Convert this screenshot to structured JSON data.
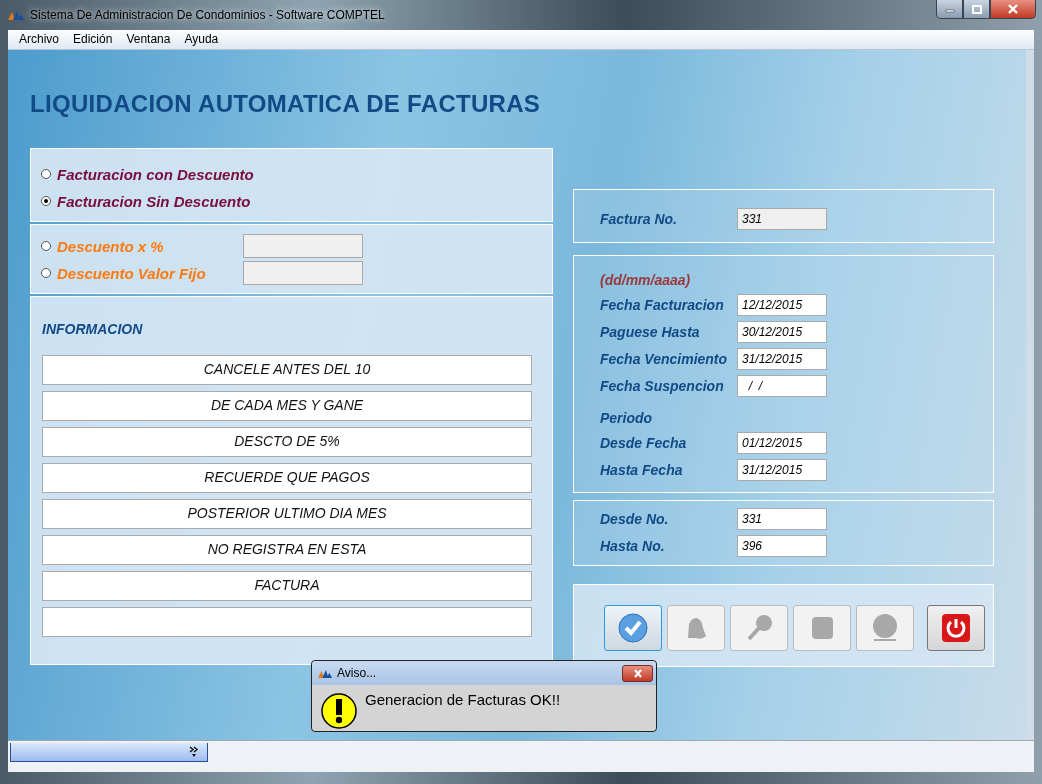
{
  "window": {
    "title": "Sistema De Administracion De Condominios - Software COMPTEL"
  },
  "menu": [
    "Archivo",
    "Edición",
    "Ventana",
    "Ayuda"
  ],
  "heading": "LIQUIDACION AUTOMATICA DE FACTURAS",
  "billing_options": [
    {
      "label": "Facturacion con Descuento",
      "selected": false
    },
    {
      "label": "Facturacion Sin Descuento",
      "selected": true
    }
  ],
  "discount_options": [
    {
      "label": "Descuento x %",
      "selected": false
    },
    {
      "label": "Descuento Valor Fijo",
      "selected": false
    }
  ],
  "information": {
    "title": "INFORMACION",
    "rows": [
      {
        "text": "CANCELE ANTES DEL 10"
      },
      {
        "text": "DE CADA  MES Y GANE"
      },
      {
        "text": "DESCTO DE 5%"
      },
      {
        "text": "RECUERDE QUE PAGOS"
      },
      {
        "text": "POSTERIOR ULTIMO DIA MES"
      },
      {
        "text": "NO REGISTRA EN ESTA"
      },
      {
        "text": "FACTURA"
      },
      {}
    ]
  },
  "invoice": {
    "label": "Factura No.",
    "value": "331"
  },
  "dates": [
    {
      "kind": "hint",
      "label": "(dd/mm/aaaa)"
    },
    {
      "kind": "field",
      "label": "Fecha Facturacion",
      "value": "12/12/2015"
    },
    {
      "kind": "field",
      "label": "Paguese Hasta",
      "value": "30/12/2015"
    },
    {
      "kind": "field",
      "label": "Fecha Vencimiento",
      "value": "31/12/2015"
    },
    {
      "kind": "field",
      "label": "Fecha Suspencion",
      "value": "  /  /"
    },
    {
      "kind": "heading",
      "label": "Periodo"
    },
    {
      "kind": "field",
      "label": "Desde Fecha",
      "value": "01/12/2015"
    },
    {
      "kind": "field",
      "label": "Hasta Fecha",
      "value": "31/12/2015"
    }
  ],
  "numbers": [
    {
      "label": "Desde No.",
      "value": "331"
    },
    {
      "label": "Hasta No.",
      "value": "396"
    }
  ],
  "toolbar": [
    {
      "kind": "check",
      "disabled": false,
      "selected": true
    },
    {
      "kind": "bell",
      "disabled": true,
      "selected": false
    },
    {
      "kind": "key",
      "disabled": true,
      "selected": false
    },
    {
      "kind": "square",
      "disabled": true,
      "selected": false
    },
    {
      "kind": "circle",
      "disabled": true,
      "selected": false
    },
    {
      "kind": "power",
      "disabled": false,
      "selected": false
    }
  ],
  "dialog": {
    "title": "Aviso...",
    "message": "Generacion de Facturas OK!!"
  }
}
